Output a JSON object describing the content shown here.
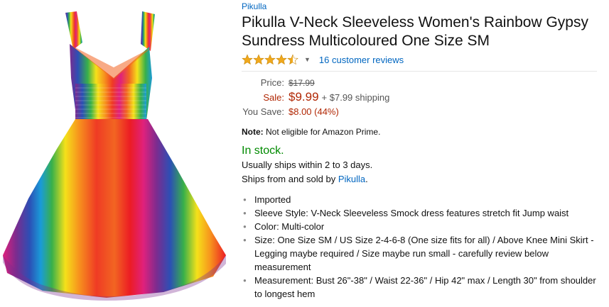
{
  "brand": "Pikulla",
  "title": "Pikulla V-Neck Sleeveless Women's Rainbow Gypsy Sundress Multicoloured One Size SM",
  "rating": {
    "stars": 4,
    "out_of": 5,
    "reviews_label": "16 customer reviews"
  },
  "price": {
    "price_label": "Price:",
    "list_price": "$17.99",
    "sale_label": "Sale:",
    "sale_price": "$9.99",
    "shipping": "+ $7.99 shipping",
    "save_label": "You Save:",
    "save_value": "$8.00 (44%)"
  },
  "note": {
    "label": "Note:",
    "text": " Not eligible for Amazon Prime."
  },
  "availability": {
    "stock": "In stock.",
    "ships_within": "Usually ships within 2 to 3 days.",
    "sold_by_prefix": "Ships from and sold by ",
    "seller": "Pikulla",
    "sold_by_suffix": "."
  },
  "bullets": [
    "Imported",
    "Sleeve Style: V-Neck Sleeveless Smock dress features stretch fit Jump waist",
    "Color: Multi-color",
    "Size: One Size SM / US Size 2-4-6-8 (One size fits for all) / Above Knee Mini Skirt - Legging maybe required / Size maybe run small - carefully review below measurement",
    "Measurement: Bust 26\"-38\" / Waist 22-36\" / Hip 42\" max / Length 30\" from shoulder to longest hem"
  ],
  "colors": {
    "link": "#0066c0",
    "price_red": "#b12704",
    "stock_green": "#008a00",
    "star": "#f0a81c"
  },
  "icons": {
    "star": "star-icon",
    "caret": "caret-down-icon"
  }
}
